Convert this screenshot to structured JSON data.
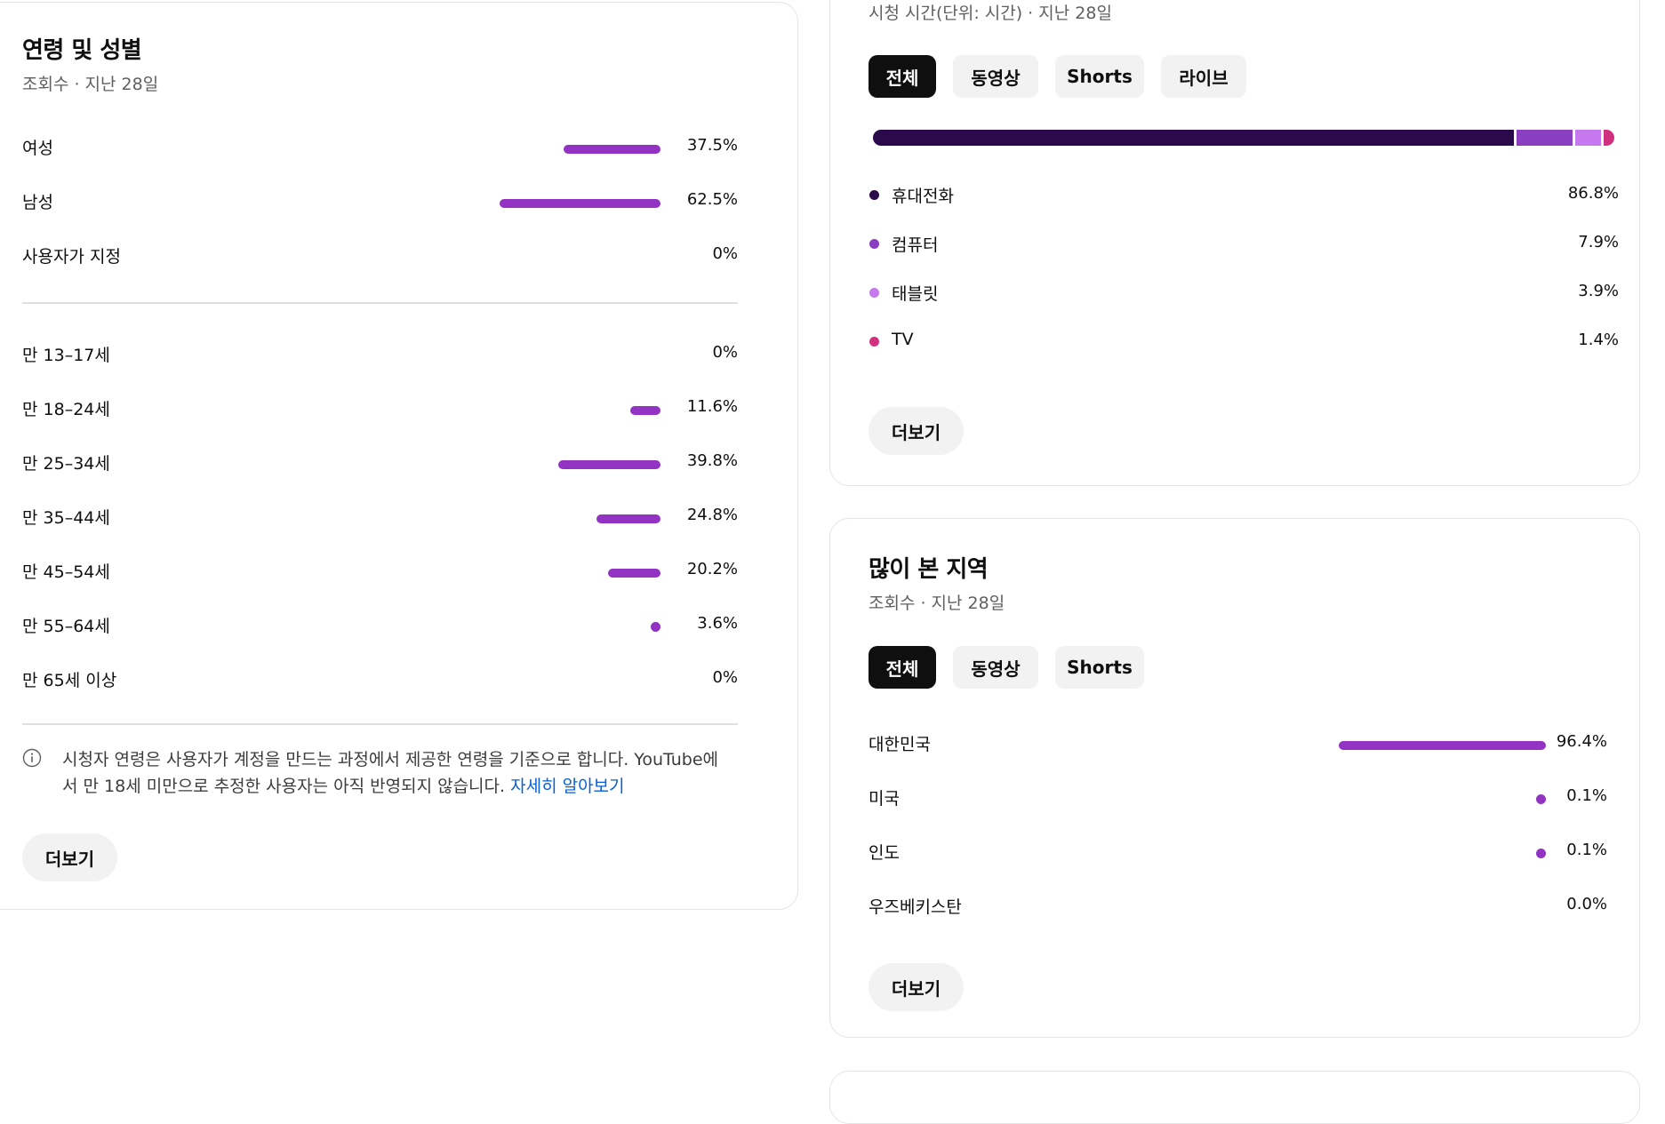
{
  "age_gender": {
    "title": "연령 및 성별",
    "subtitle": "조회수 · 지난 28일",
    "gender_rows": [
      {
        "label": "여성",
        "value": "37.5%",
        "pct": 37.5
      },
      {
        "label": "남성",
        "value": "62.5%",
        "pct": 62.5
      },
      {
        "label": "사용자가 지정",
        "value": "0%",
        "pct": 0
      }
    ],
    "age_rows": [
      {
        "label": "만 13–17세",
        "value": "0%",
        "pct": 0
      },
      {
        "label": "만 18–24세",
        "value": "11.6%",
        "pct": 11.6
      },
      {
        "label": "만 25–34세",
        "value": "39.8%",
        "pct": 39.8
      },
      {
        "label": "만 35–44세",
        "value": "24.8%",
        "pct": 24.8
      },
      {
        "label": "만 45–54세",
        "value": "20.2%",
        "pct": 20.2
      },
      {
        "label": "만 55–64세",
        "value": "3.6%",
        "pct": 3.6
      },
      {
        "label": "만 65세 이상",
        "value": "0%",
        "pct": 0
      }
    ],
    "info_line1": "시청자 연령은 사용자가 계정을 만드는 과정에서 제공한 연령을 기준으로 합니다. YouTube에",
    "info_line2": "서 만 18세 미만으로 추정한 사용자는 아직 반영되지 않습니다.",
    "info_link": "자세히 알아보기",
    "more_label": "더보기"
  },
  "device": {
    "subtitle": "시청 시간(단위: 시간) · 지난 28일",
    "tabs": [
      {
        "label": "전체",
        "active": true
      },
      {
        "label": "동영상",
        "active": false
      },
      {
        "label": "Shorts",
        "active": false
      },
      {
        "label": "라이브",
        "active": false
      }
    ],
    "rows": [
      {
        "label": "휴대전화",
        "value": "86.8%",
        "pct": 86.8,
        "color": "#2a0a4a"
      },
      {
        "label": "컴퓨터",
        "value": "7.9%",
        "pct": 7.9,
        "color": "#8a3fc0"
      },
      {
        "label": "태블릿",
        "value": "3.9%",
        "pct": 3.9,
        "color": "#c678ee"
      },
      {
        "label": "TV",
        "value": "1.4%",
        "pct": 1.4,
        "color": "#d0307e"
      }
    ],
    "more_label": "더보기"
  },
  "region": {
    "title": "많이 본 지역",
    "subtitle": "조회수 · 지난 28일",
    "tabs": [
      {
        "label": "전체",
        "active": true
      },
      {
        "label": "동영상",
        "active": false
      },
      {
        "label": "Shorts",
        "active": false
      }
    ],
    "rows": [
      {
        "label": "대한민국",
        "value": "96.4%",
        "pct": 96.4
      },
      {
        "label": "미국",
        "value": "0.1%",
        "pct": 0.1
      },
      {
        "label": "인도",
        "value": "0.1%",
        "pct": 0.1
      },
      {
        "label": "우즈베키스탄",
        "value": "0.0%",
        "pct": 0
      }
    ],
    "more_label": "더보기"
  },
  "colors": {
    "bar": "#9333c4",
    "active_chip": "#0f0f0f",
    "chip": "#f2f2f2",
    "link": "#065fd4"
  }
}
